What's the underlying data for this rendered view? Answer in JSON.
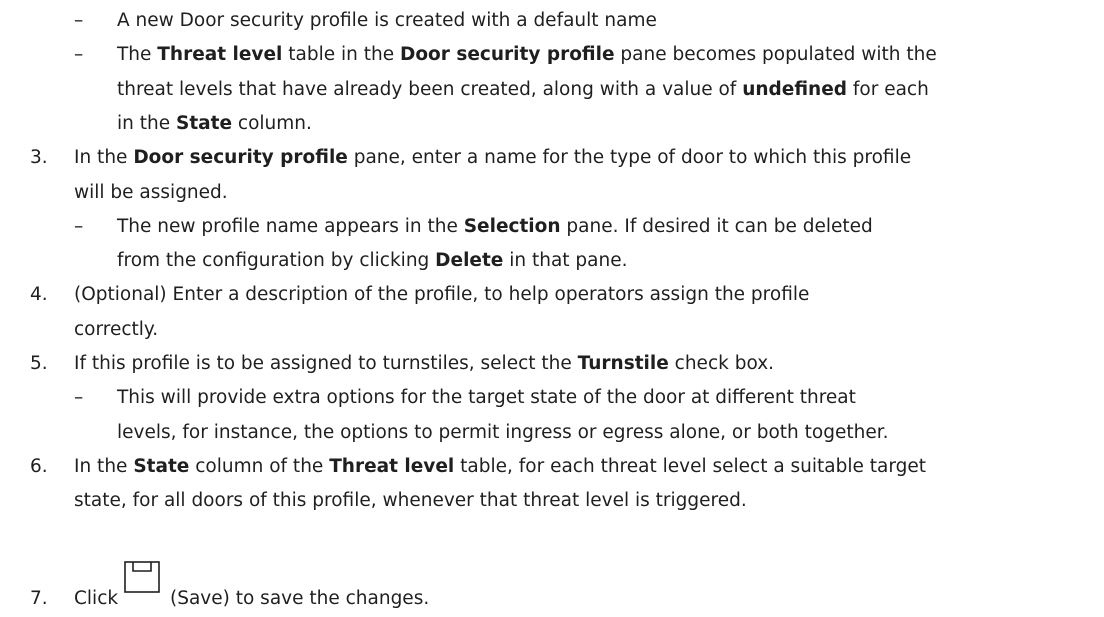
{
  "items": [
    {
      "type": "sub",
      "segments": [
        {
          "t": "A new Door security profile is created with a default name",
          "b": false
        }
      ]
    },
    {
      "type": "sub",
      "segments": [
        {
          "t": "The ",
          "b": false
        },
        {
          "t": "Threat level",
          "b": true
        },
        {
          "t": " table in the ",
          "b": false
        },
        {
          "t": "Door security profile",
          "b": true
        },
        {
          "t": " pane becomes populated with the",
          "b": false
        }
      ]
    },
    {
      "type": "cont2",
      "segments": [
        {
          "t": "threat levels that have already been created, along with a value of ",
          "b": false
        },
        {
          "t": "undefined",
          "b": true
        },
        {
          "t": " for each",
          "b": false
        }
      ]
    },
    {
      "type": "cont2",
      "segments": [
        {
          "t": "in the ",
          "b": false
        },
        {
          "t": "State",
          "b": true
        },
        {
          "t": " column.",
          "b": false
        }
      ]
    },
    {
      "type": "step",
      "num": "3.",
      "segments": [
        {
          "t": "In the ",
          "b": false
        },
        {
          "t": "Door security profile",
          "b": true
        },
        {
          "t": " pane, enter a name for the type of door to which this profile",
          "b": false
        }
      ]
    },
    {
      "type": "cont1",
      "segments": [
        {
          "t": "will be assigned.",
          "b": false
        }
      ]
    },
    {
      "type": "sub",
      "segments": [
        {
          "t": "The new profile name appears in the ",
          "b": false
        },
        {
          "t": "Selection",
          "b": true
        },
        {
          "t": " pane. If desired it can be deleted",
          "b": false
        }
      ]
    },
    {
      "type": "cont2",
      "segments": [
        {
          "t": "from the configuration by clicking ",
          "b": false
        },
        {
          "t": "Delete",
          "b": true
        },
        {
          "t": " in that pane.",
          "b": false
        }
      ]
    },
    {
      "type": "step",
      "num": "4.",
      "segments": [
        {
          "t": "(Optional) Enter a description of the profile, to help operators assign the profile",
          "b": false
        }
      ]
    },
    {
      "type": "cont1",
      "segments": [
        {
          "t": "correctly.",
          "b": false
        }
      ]
    },
    {
      "type": "step",
      "num": "5.",
      "segments": [
        {
          "t": "If this profile is to be assigned to turnstiles, select the ",
          "b": false
        },
        {
          "t": "Turnstile",
          "b": true
        },
        {
          "t": " check box.",
          "b": false
        }
      ]
    },
    {
      "type": "sub",
      "segments": [
        {
          "t": "This will provide extra options for the target state of the door at different threat",
          "b": false
        }
      ]
    },
    {
      "type": "cont2",
      "segments": [
        {
          "t": "levels, for instance, the options to permit ingress or egress alone, or both together.",
          "b": false
        }
      ]
    },
    {
      "type": "step",
      "num": "6.",
      "segments": [
        {
          "t": "In the ",
          "b": false
        },
        {
          "t": "State",
          "b": true
        },
        {
          "t": " column of the ",
          "b": false
        },
        {
          "t": "Threat level",
          "b": true
        },
        {
          "t": " table, for each threat level select a suitable target",
          "b": false
        }
      ]
    },
    {
      "type": "cont1",
      "segments": [
        {
          "t": "state, for all doors of this profile, whenever that threat level is triggered.",
          "b": false
        }
      ]
    }
  ],
  "dash_glyph": "–",
  "step7": {
    "num": "7.",
    "before": "Click",
    "icon": "save-icon",
    "after": "(Save) to save the changes."
  }
}
